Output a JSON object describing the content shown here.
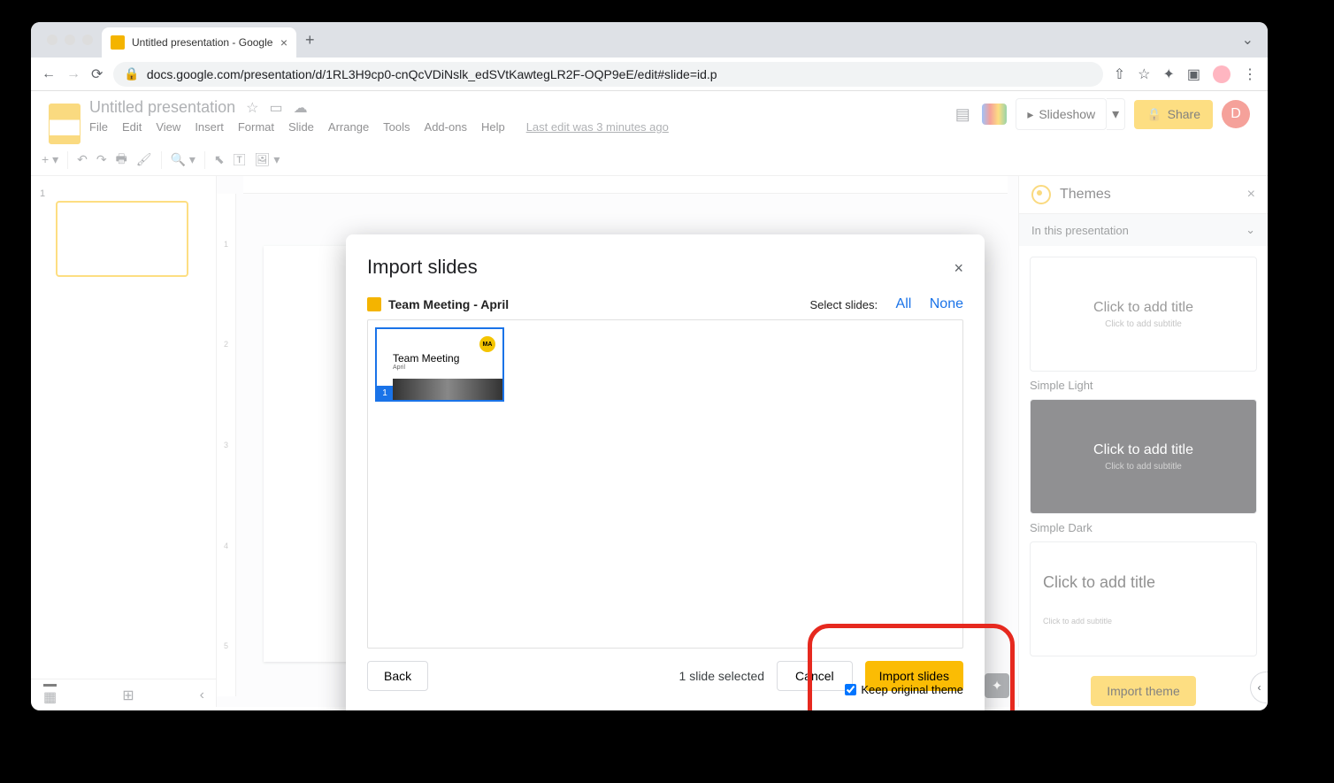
{
  "browser": {
    "tab_title": "Untitled presentation - Google",
    "url": "docs.google.com/presentation/d/1RL3H9cp0-cnQcVDiNslk_edSVtKawtegLR2F-OQP9eE/edit#slide=id.p"
  },
  "header": {
    "doc_title": "Untitled presentation",
    "menus": [
      "File",
      "Edit",
      "View",
      "Insert",
      "Format",
      "Slide",
      "Arrange",
      "Tools",
      "Add-ons",
      "Help"
    ],
    "status": "Last edit was 3 minutes ago",
    "slideshow": "Slideshow",
    "share": "Share",
    "avatar": "D"
  },
  "filmstrip": {
    "slide_number": "1"
  },
  "ruler_v": [
    "1",
    "2",
    "3",
    "4",
    "5"
  ],
  "themes": {
    "title": "Themes",
    "subtitle": "In this presentation",
    "card_title": "Click to add title",
    "card_subtitle": "Click to add subtitle",
    "card_subtitle2": "Click to add subtitle",
    "labels": [
      "Simple Light",
      "Simple Dark"
    ],
    "import": "Import theme"
  },
  "modal": {
    "title": "Import slides",
    "file_name": "Team Meeting - April",
    "select_label": "Select slides:",
    "select_all": "All",
    "select_none": "None",
    "thumb": {
      "num": "1",
      "logo": "MA",
      "title": "Team Meeting",
      "sub": "April"
    },
    "keep_theme": "Keep original theme",
    "back": "Back",
    "status": "1 slide selected",
    "cancel": "Cancel",
    "import": "Import slides"
  }
}
